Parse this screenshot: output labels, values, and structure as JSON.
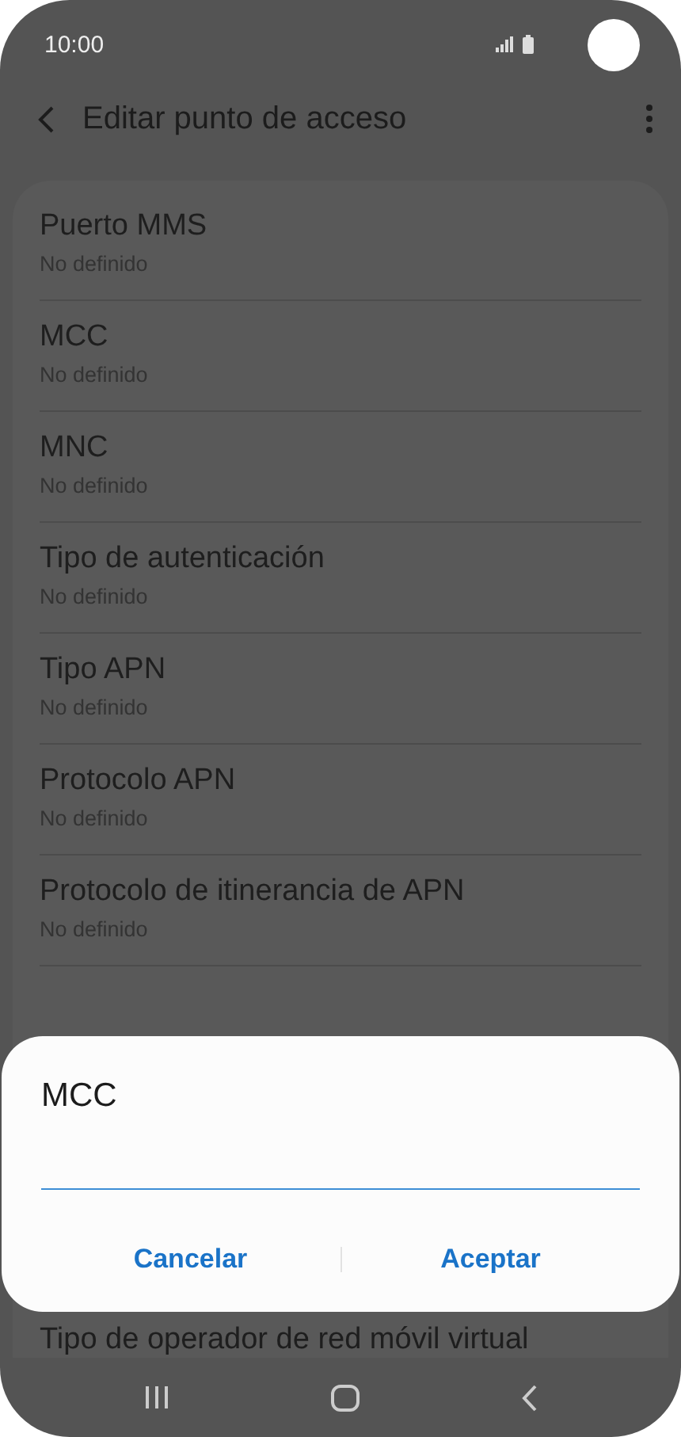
{
  "status_bar": {
    "time": "10:00"
  },
  "header": {
    "title": "Editar punto de acceso"
  },
  "settings": [
    {
      "title": "Puerto MMS",
      "value": "No definido"
    },
    {
      "title": "MCC",
      "value": "No definido"
    },
    {
      "title": "MNC",
      "value": "No definido"
    },
    {
      "title": "Tipo de autenticación",
      "value": "No definido"
    },
    {
      "title": "Tipo APN",
      "value": "No definido"
    },
    {
      "title": "Protocolo APN",
      "value": "No definido"
    },
    {
      "title": "Protocolo de itinerancia de APN",
      "value": "No definido"
    }
  ],
  "partial_item": {
    "title": "Tipo de operador de red móvil virtual"
  },
  "dialog": {
    "title": "MCC",
    "buttons": [
      "Cancelar",
      "Aceptar"
    ]
  }
}
